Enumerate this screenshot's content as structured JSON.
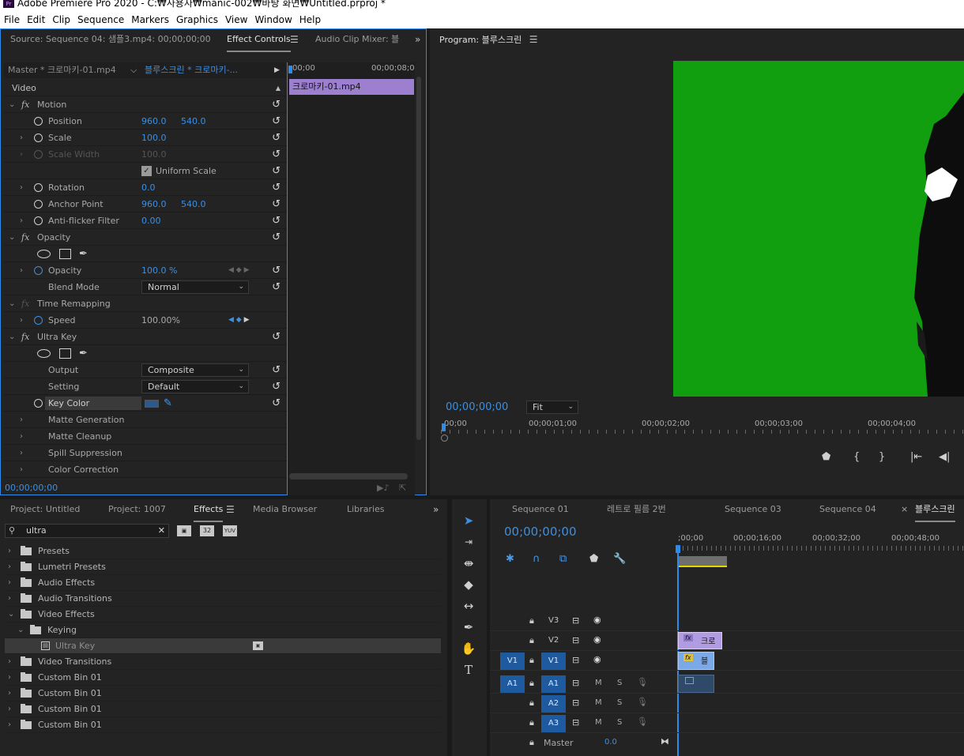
{
  "window": {
    "title": "Adobe Premiere Pro 2020 - C:₩사용자₩manic-002₩바탕 화면₩Untitled.prproj *",
    "app_icon": "Pr"
  },
  "menu": [
    "File",
    "Edit",
    "Clip",
    "Sequence",
    "Markers",
    "Graphics",
    "View",
    "Window",
    "Help"
  ],
  "source_panel": {
    "tabs": {
      "source": "Source: Sequence 04: 샘플3.mp4: 00;00;00;00",
      "effect_controls": "Effect Controls",
      "audio_mixer": "Audio Clip Mixer: 블"
    },
    "master_label": "Master * 크로마키-01.mp4",
    "sequence_label": "블루스크린 * 크로마키-...",
    "mini_timeline": {
      "t0": "00;00",
      "t1": "00;00;08;0",
      "clip": "크로마키-01.mp4"
    },
    "section_video": "Video",
    "motion": {
      "label": "Motion",
      "position": {
        "label": "Position",
        "x": "960.0",
        "y": "540.0"
      },
      "scale": {
        "label": "Scale",
        "value": "100.0"
      },
      "scale_width": {
        "label": "Scale Width",
        "value": "100.0"
      },
      "uniform_scale": "Uniform Scale",
      "rotation": {
        "label": "Rotation",
        "value": "0.0"
      },
      "anchor": {
        "label": "Anchor Point",
        "x": "960.0",
        "y": "540.0"
      },
      "antiflicker": {
        "label": "Anti-flicker Filter",
        "value": "0.00"
      }
    },
    "opacity": {
      "label": "Opacity",
      "opacity_label": "Opacity",
      "value": "100.0 %",
      "blend_label": "Blend Mode",
      "blend_value": "Normal"
    },
    "time_remap": {
      "label": "Time Remapping",
      "speed_label": "Speed",
      "speed_value": "100.00%"
    },
    "ultra_key": {
      "label": "Ultra Key",
      "output_label": "Output",
      "output_value": "Composite",
      "setting_label": "Setting",
      "setting_value": "Default",
      "key_color_label": "Key Color",
      "key_color": "#2d5a8e",
      "matte_gen": "Matte Generation",
      "matte_cleanup": "Matte Cleanup",
      "spill": "Spill Suppression",
      "color_correction": "Color Correction"
    },
    "timecode": "00;00;00;00"
  },
  "program": {
    "title": "Program: 블루스크린",
    "timecode": "00;00;00;00",
    "fit": "Fit",
    "ruler": [
      "00;00",
      "00;00;01;00",
      "00;00;02;00",
      "00;00;03;00",
      "00;00;04;00"
    ],
    "green": "#119e0f"
  },
  "effects_panel": {
    "tabs": {
      "project1": "Project: Untitled",
      "project2": "Project: 1007",
      "effects": "Effects",
      "media": "Media Browser",
      "libraries": "Libraries"
    },
    "search": "ultra",
    "badges": [
      "32",
      "YUV"
    ],
    "items": [
      {
        "label": "Presets",
        "level": 0
      },
      {
        "label": "Lumetri Presets",
        "level": 0
      },
      {
        "label": "Audio Effects",
        "level": 0
      },
      {
        "label": "Audio Transitions",
        "level": 0
      },
      {
        "label": "Video Effects",
        "level": 0,
        "open": true
      },
      {
        "label": "Keying",
        "level": 1,
        "open": true
      },
      {
        "label": "Ultra Key",
        "level": 2,
        "effect": true
      },
      {
        "label": "Video Transitions",
        "level": 0
      },
      {
        "label": "Custom Bin 01",
        "level": 0
      },
      {
        "label": "Custom Bin 01",
        "level": 0
      },
      {
        "label": "Custom Bin 01",
        "level": 0
      },
      {
        "label": "Custom Bin 01",
        "level": 0
      }
    ]
  },
  "timeline": {
    "tabs": [
      "Sequence 01",
      "레트로 필름 2번",
      "Sequence 03",
      "Sequence 04",
      "블루스크린"
    ],
    "timecode": "00;00;00;00",
    "ruler": [
      ";00;00",
      "00;00;16;00",
      "00;00;32;00",
      "00;00;48;00"
    ],
    "tracks": {
      "v3": "V3",
      "v2": "V2",
      "v1_src": "V1",
      "v1": "V1",
      "a1_src": "A1",
      "a1": "A1",
      "a2": "A2",
      "a3": "A3",
      "m": "M",
      "s": "S",
      "master": "Master",
      "master_value": "0.0"
    },
    "clips": {
      "v2": "크로",
      "v1": "블"
    }
  }
}
